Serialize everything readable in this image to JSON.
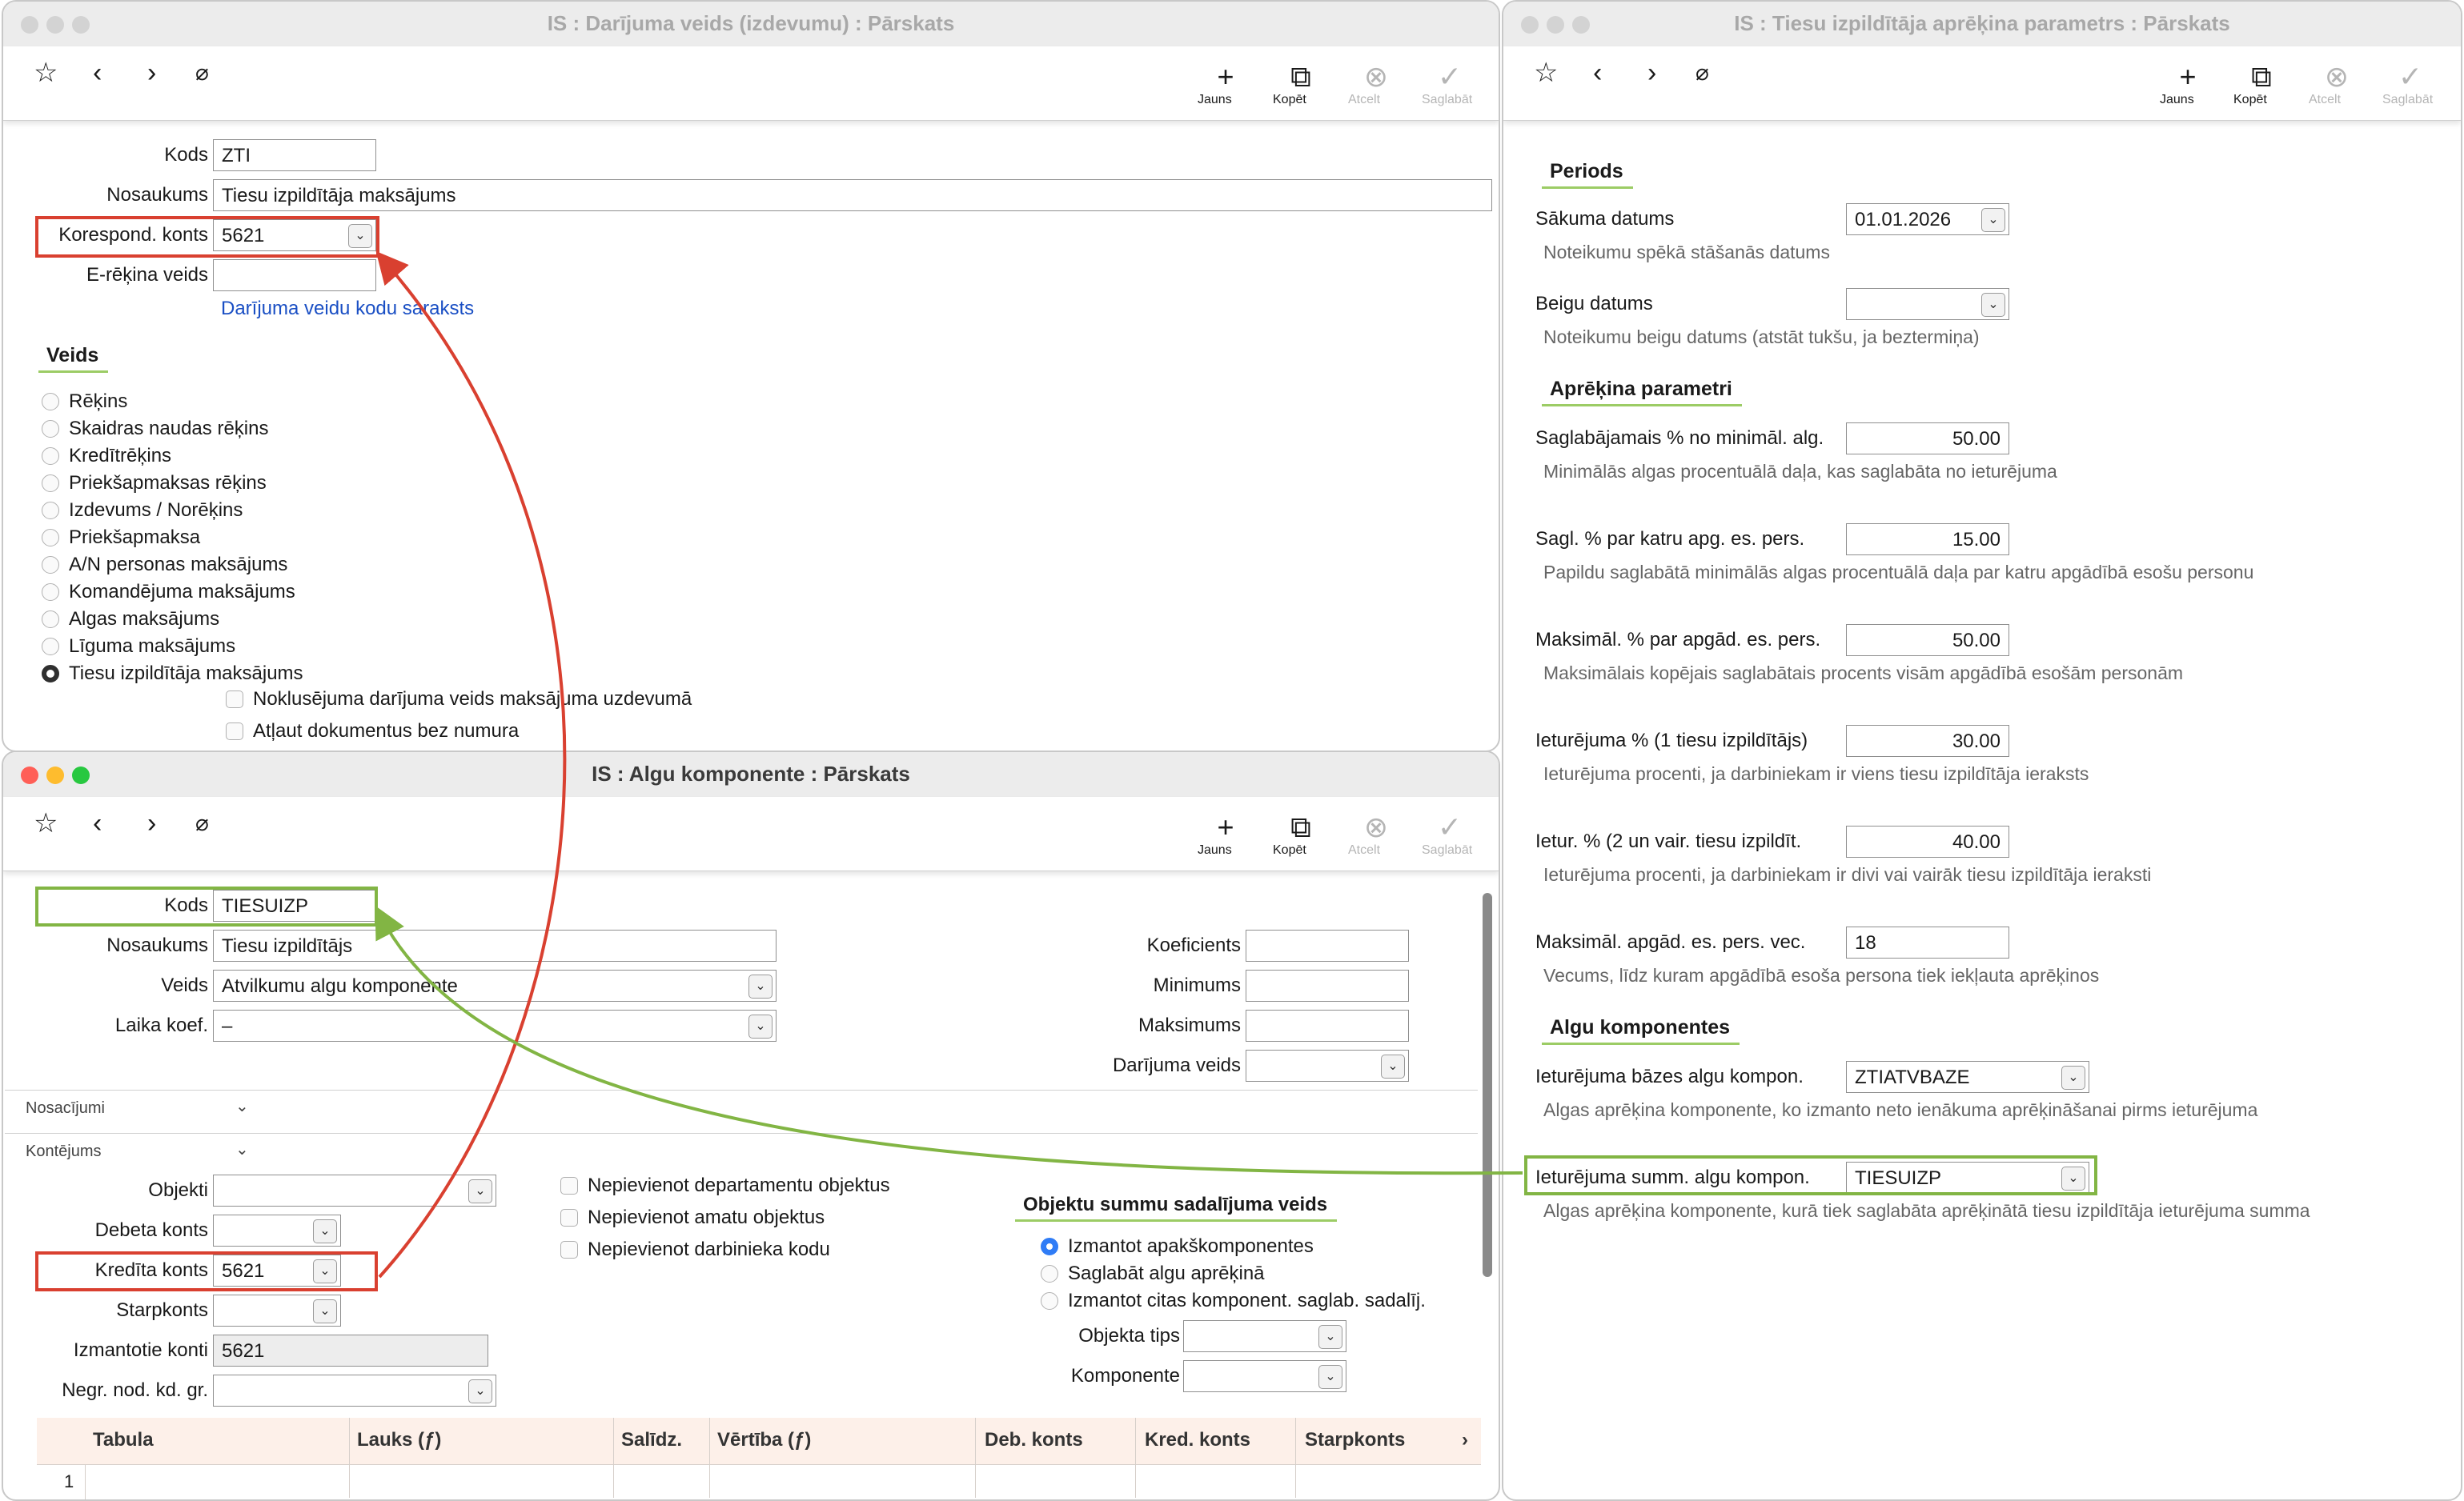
{
  "win1": {
    "title": "IS : Darījuma veids (izdevumu) : Pārskats",
    "toolbar": {
      "new": "Jauns",
      "copy": "Kopēt",
      "cancel": "Atcelt",
      "save": "Saglabāt"
    },
    "fields": {
      "kods_label": "Kods",
      "kods_value": "ZTI",
      "nos_label": "Nosaukums",
      "nos_value": "Tiesu izpildītāja maksājums",
      "konts_label": "Korespond. konts",
      "konts_value": "5621",
      "erek_label": "E-rēķina veids",
      "erek_value": ""
    },
    "link": "Darījuma veidu kodu saraksts",
    "veids_title": "Veids",
    "radios": [
      "Rēķins",
      "Skaidras naudas rēķins",
      "Kredītrēķins",
      "Priekšapmaksas rēķins",
      "Izdevums / Norēķins",
      "Priekšapmaksa",
      "A/N personas maksājums",
      "Komandējuma maksājums",
      "Algas maksājums",
      "Līguma maksājums",
      "Tiesu izpildītāja maksājums"
    ],
    "selected_radio": "Tiesu izpildītāja maksājums",
    "checks": [
      "Noklusējuma darījuma veids maksājuma uzdevumā",
      "Atļaut dokumentus bez numura"
    ]
  },
  "win2": {
    "title": "IS : Tiesu izpildītāja aprēķina parametrs : Pārskats",
    "toolbar": {
      "new": "Jauns",
      "copy": "Kopēt",
      "cancel": "Atcelt",
      "save": "Saglabāt"
    },
    "periods_title": "Periods",
    "sakuma_label": "Sākuma datums",
    "sakuma_value": "01.01.2026",
    "sakuma_hint": "Noteikumu spēkā stāšanās datums",
    "beigu_label": "Beigu datums",
    "beigu_value": "",
    "beigu_hint": "Noteikumu beigu datums (atstāt tukšu, ja beztermiņa)",
    "params_title": "Aprēķina parametri",
    "p1_label": "Saglabājamais % no minimāl. alg.",
    "p1_value": "50.00",
    "p1_hint": "Minimālās algas procentuālā daļa, kas saglabāta no ieturējuma",
    "p2_label": "Sagl. % par katru apg. es. pers.",
    "p2_value": "15.00",
    "p2_hint": "Papildu saglabātā minimālās algas procentuālā daļa par katru apgādībā esošu personu",
    "p3_label": "Maksimāl. % par apgād. es. pers.",
    "p3_value": "50.00",
    "p3_hint": "Maksimālais kopējais saglabātais procents visām apgādībā esošām personām",
    "p4_label": "Ieturējuma % (1 tiesu izpildītājs)",
    "p4_value": "30.00",
    "p4_hint": "Ieturējuma procenti, ja darbiniekam ir viens tiesu izpildītāja ieraksts",
    "p5_label": "Ietur. % (2 un vair. tiesu izpildīt.",
    "p5_value": "40.00",
    "p5_hint": "Ieturējuma procenti, ja darbiniekam ir divi vai vairāk tiesu izpildītāja ieraksti",
    "p6_label": "Maksimāl. apgād. es. pers. vec.",
    "p6_value": "18",
    "p6_hint": "Vecums, līdz kuram apgādībā esoša persona tiek iekļauta aprēķinos",
    "algu_title": "Algu komponentes",
    "a1_label": "Ieturējuma bāzes algu kompon.",
    "a1_value": "ZTIATVBAZE",
    "a1_hint": "Algas aprēķina komponente, ko izmanto neto ienākuma aprēķināšanai pirms ieturējuma",
    "a2_label": "Ieturējuma summ. algu kompon.",
    "a2_value": "TIESUIZP",
    "a2_hint": "Algas aprēķina komponente, kurā tiek saglabāta aprēķinātā tiesu izpildītāja ieturējuma summa"
  },
  "win3": {
    "title": "IS : Algu komponente : Pārskats",
    "toolbar": {
      "new": "Jauns",
      "copy": "Kopēt",
      "cancel": "Atcelt",
      "save": "Saglabāt"
    },
    "kods_label": "Kods",
    "kods_value": "TIESUIZP",
    "nos_label": "Nosaukums",
    "nos_value": "Tiesu izpildītājs",
    "veids_label": "Veids",
    "veids_value": "Atvilkumu algu komponente",
    "laika_label": "Laika koef.",
    "laika_value": "–",
    "koef_label": "Koeficients",
    "koef_value": "",
    "min_label": "Minimums",
    "min_value": "",
    "max_label": "Maksimums",
    "max_value": "",
    "darij_label": "Darījuma veids",
    "darij_value": "",
    "nosacijumi": "Nosacījumi",
    "kontejums": "Kontējums",
    "objekti_label": "Objekti",
    "objekti_value": "",
    "debeta_label": "Debeta konts",
    "debeta_value": "",
    "kredita_label": "Kredīta konts",
    "kredita_value": "5621",
    "starp_label": "Starpkonts",
    "starp_value": "",
    "izm_label": "Izmantotie konti",
    "izm_value": "5621",
    "negr_label": "Negr. nod. kd. gr.",
    "negr_value": "",
    "checks": [
      "Nepievienot departamentu objektus",
      "Nepievienot amatu objektus",
      "Nepievienot darbinieka kodu"
    ],
    "obj_title": "Objektu summu sadalījuma veids",
    "obj_radios": [
      "Izmantot apakškomponentes",
      "Saglabāt algu aprēķinā",
      "Izmantot citas komponent. saglab. sadalīj."
    ],
    "obj_tips_label": "Objekta tips",
    "obj_tips_value": "",
    "komp_label": "Komponente",
    "komp_value": "",
    "grid_headers": [
      "Tabula",
      "Lauks (ƒ)",
      "Salīdz.",
      "Vērtība (ƒ)",
      "Deb. konts",
      "Kred. konts",
      "Starpkonts"
    ],
    "grid_more": "›",
    "grid_row1": "1"
  },
  "colors": {
    "red": "#d94030",
    "green": "#82b544",
    "section_underline": "#9ccc65",
    "link": "#1a4fc4"
  }
}
